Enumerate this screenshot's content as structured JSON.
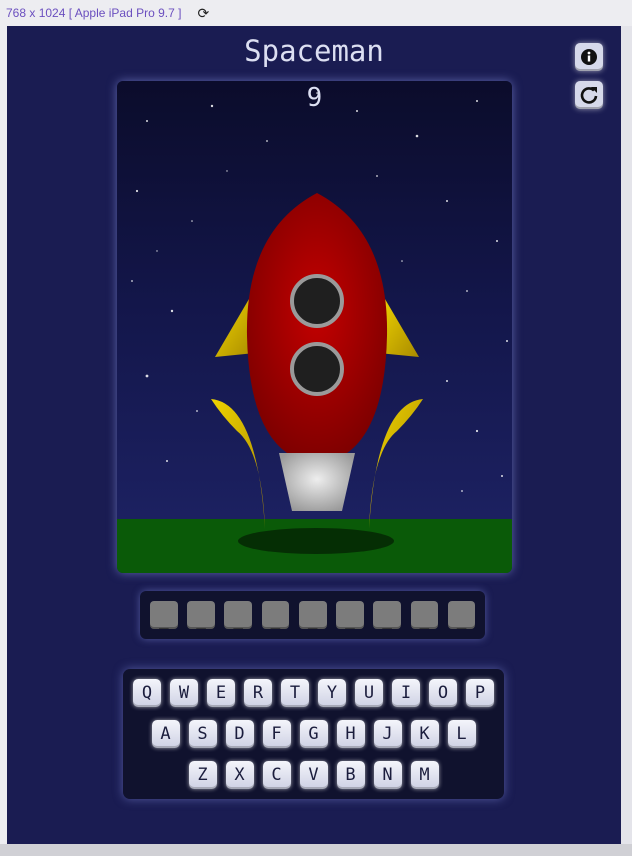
{
  "device_bar": {
    "label": "768 x 1024 [ Apple iPad Pro 9.7 ]",
    "rotate_icon": "rotate-icon"
  },
  "app": {
    "title": "Spaceman",
    "info_icon": "info-circle-icon",
    "restart_icon": "restart-icon"
  },
  "scene": {
    "lives_remaining": "9",
    "colors": {
      "rocket_body": "#b30000",
      "fins": "#e6c800",
      "ground": "#0a5a08",
      "porthole": "#1f1f1f"
    }
  },
  "word": {
    "slots": [
      "_",
      "_",
      "_",
      "_",
      "_",
      "_",
      "_",
      "_",
      "_"
    ]
  },
  "keyboard": {
    "rows": [
      [
        "Q",
        "W",
        "E",
        "R",
        "T",
        "Y",
        "U",
        "I",
        "O",
        "P"
      ],
      [
        "A",
        "S",
        "D",
        "F",
        "G",
        "H",
        "J",
        "K",
        "L"
      ],
      [
        "Z",
        "X",
        "C",
        "V",
        "B",
        "N",
        "M"
      ]
    ]
  }
}
